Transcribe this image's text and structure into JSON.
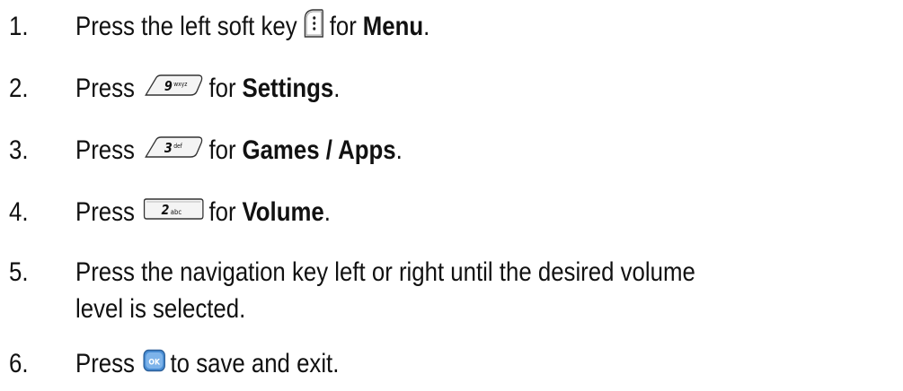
{
  "steps": [
    {
      "number": "1.",
      "parts": [
        "Press the left soft key",
        "for",
        "Menu",
        "."
      ],
      "icon": "left-soft-key-icon"
    },
    {
      "number": "2.",
      "parts": [
        "Press",
        "for",
        "Settings",
        "."
      ],
      "icon": "key-9-wxyz-icon",
      "key_digit": "9",
      "key_letters": "wxyz"
    },
    {
      "number": "3.",
      "parts": [
        "Press",
        "for",
        "Games / Apps",
        "."
      ],
      "icon": "key-3-def-icon",
      "key_digit": "3",
      "key_letters": "def"
    },
    {
      "number": "4.",
      "parts": [
        "Press",
        "for",
        "Volume",
        "."
      ],
      "icon": "key-2-abc-icon",
      "key_digit": "2",
      "key_letters": "abc"
    },
    {
      "number": "5.",
      "line1": "Press the navigation key left or right until the desired volume",
      "line2": "level is selected."
    },
    {
      "number": "6.",
      "parts": [
        "Press",
        "to save and exit."
      ],
      "icon": "ok-key-icon",
      "key_label": "OK"
    }
  ],
  "colors": {
    "text": "#111111",
    "ok_key_fill": "#4a8fd6",
    "key_outline": "#333333"
  }
}
